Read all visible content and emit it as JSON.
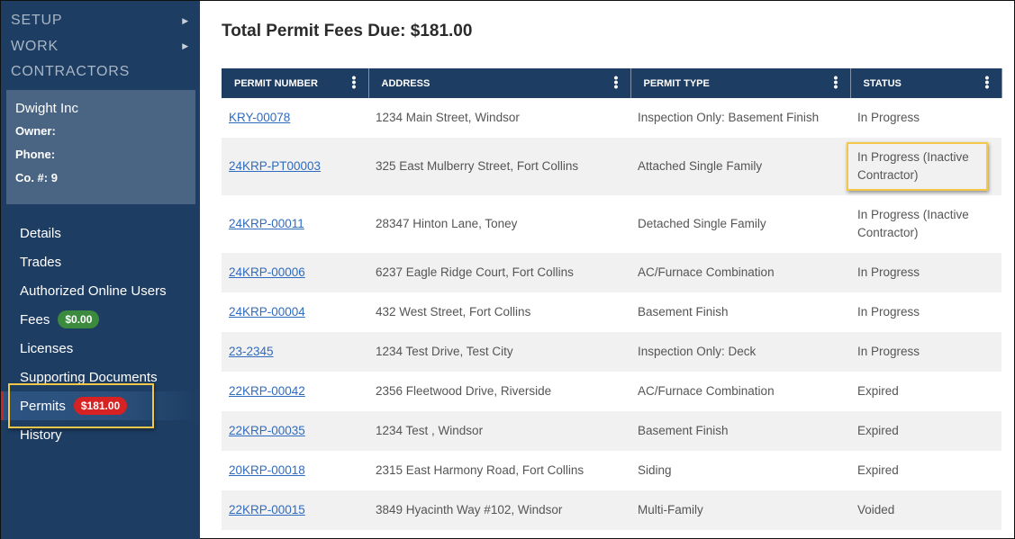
{
  "sidebar": {
    "top_nav": [
      {
        "label": "SETUP",
        "has_arrow": true
      },
      {
        "label": "WORK",
        "has_arrow": true
      },
      {
        "label": "CONTRACTORS",
        "has_arrow": false
      }
    ],
    "arrow_glyph": "▶",
    "contractor": {
      "name": "Dwight Inc",
      "owner_label": "Owner:",
      "phone_label": "Phone:",
      "company_number": "Co. #: 9"
    },
    "sub_nav": [
      {
        "label": "Details"
      },
      {
        "label": "Trades"
      },
      {
        "label": "Authorized Online Users"
      },
      {
        "label": "Fees",
        "badge": "$0.00",
        "badge_color": "#3b8a3e"
      },
      {
        "label": "Licenses"
      },
      {
        "label": "Supporting Documents"
      },
      {
        "label": "Permits",
        "badge": "$181.00",
        "badge_color": "#d62222",
        "active": true
      },
      {
        "label": "History"
      }
    ]
  },
  "main": {
    "title": "Total Permit Fees Due: $181.00",
    "table": {
      "columns": [
        "PERMIT NUMBER",
        "ADDRESS",
        "PERMIT TYPE",
        "STATUS"
      ],
      "menu_glyph": "⋮",
      "rows": [
        {
          "permit_number": "KRY-00078",
          "address": "1234 Main Street, Windsor",
          "permit_type": "Inspection Only: Basement Finish",
          "status": "In Progress"
        },
        {
          "permit_number": "24KRP-PT00003",
          "address": "325 East Mulberry Street, Fort Collins",
          "permit_type": "Attached Single Family",
          "status": "In Progress (Inactive Contractor)"
        },
        {
          "permit_number": "24KRP-00011",
          "address": "28347 Hinton Lane, Toney",
          "permit_type": "Detached Single Family",
          "status": "In Progress (Inactive Contractor)"
        },
        {
          "permit_number": "24KRP-00006",
          "address": "6237 Eagle Ridge Court, Fort Collins",
          "permit_type": "AC/Furnace Combination",
          "status": "In Progress"
        },
        {
          "permit_number": "24KRP-00004",
          "address": "432 West Street, Fort Collins",
          "permit_type": "Basement Finish",
          "status": "In Progress"
        },
        {
          "permit_number": "23-2345",
          "address": "1234 Test Drive, Test City",
          "permit_type": "Inspection Only: Deck",
          "status": "In Progress"
        },
        {
          "permit_number": "22KRP-00042",
          "address": "2356 Fleetwood Drive, Riverside",
          "permit_type": "AC/Furnace Combination",
          "status": "Expired"
        },
        {
          "permit_number": "22KRP-00035",
          "address": "1234 Test , Windsor",
          "permit_type": "Basement Finish",
          "status": "Expired"
        },
        {
          "permit_number": "20KRP-00018",
          "address": "2315 East Harmony Road, Fort Collins",
          "permit_type": "Siding",
          "status": "Expired"
        },
        {
          "permit_number": "22KRP-00015",
          "address": "3849 Hyacinth Way #102, Windsor",
          "permit_type": "Multi-Family",
          "status": "Voided"
        }
      ]
    }
  },
  "colors": {
    "sidebar_bg": "#1d3d62",
    "header_bg": "#1d3d62",
    "link": "#2f6bbf",
    "highlight": "#f3c74a"
  }
}
